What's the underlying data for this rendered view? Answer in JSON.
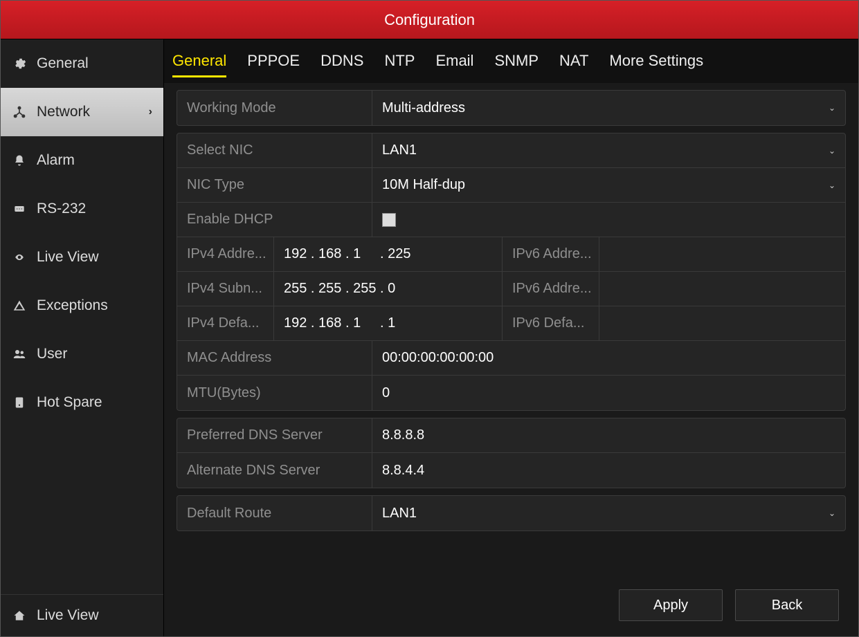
{
  "header": {
    "title": "Configuration"
  },
  "sidebar": {
    "items": [
      {
        "id": "general",
        "label": "General",
        "icon": "gear-icon"
      },
      {
        "id": "network",
        "label": "Network",
        "icon": "network-icon",
        "active": true
      },
      {
        "id": "alarm",
        "label": "Alarm",
        "icon": "bell-icon"
      },
      {
        "id": "rs232",
        "label": "RS-232",
        "icon": "serial-icon"
      },
      {
        "id": "liveview",
        "label": "Live View",
        "icon": "eye-icon"
      },
      {
        "id": "exceptions",
        "label": "Exceptions",
        "icon": "warning-icon"
      },
      {
        "id": "user",
        "label": "User",
        "icon": "users-icon"
      },
      {
        "id": "hotspare",
        "label": "Hot Spare",
        "icon": "disk-icon"
      }
    ],
    "bottom": {
      "label": "Live View",
      "icon": "home-icon"
    }
  },
  "tabs": [
    {
      "id": "general",
      "label": "General",
      "active": true
    },
    {
      "id": "pppoe",
      "label": "PPPOE"
    },
    {
      "id": "ddns",
      "label": "DDNS"
    },
    {
      "id": "ntp",
      "label": "NTP"
    },
    {
      "id": "email",
      "label": "Email"
    },
    {
      "id": "snmp",
      "label": "SNMP"
    },
    {
      "id": "nat",
      "label": "NAT"
    },
    {
      "id": "more",
      "label": "More Settings"
    }
  ],
  "form": {
    "working_mode": {
      "label": "Working Mode",
      "value": "Multi-address"
    },
    "select_nic": {
      "label": "Select NIC",
      "value": "LAN1"
    },
    "nic_type": {
      "label": "NIC Type",
      "value": "10M Half-dup"
    },
    "enable_dhcp": {
      "label": "Enable DHCP",
      "checked": false
    },
    "ipv4_address": {
      "label": "IPv4 Addre...",
      "value": "192 . 168 . 1     . 225"
    },
    "ipv4_subnet": {
      "label": "IPv4 Subn...",
      "value": "255 . 255 . 255 . 0"
    },
    "ipv4_gateway": {
      "label": "IPv4 Defa...",
      "value": "192 . 168 . 1     . 1"
    },
    "ipv6_address": {
      "label": "IPv6 Addre...",
      "value": ""
    },
    "ipv6_address2": {
      "label": "IPv6 Addre...",
      "value": ""
    },
    "ipv6_gateway": {
      "label": "IPv6 Defa...",
      "value": ""
    },
    "mac_address": {
      "label": "MAC Address",
      "value": "00:00:00:00:00:00"
    },
    "mtu": {
      "label": "MTU(Bytes)",
      "value": "0"
    },
    "dns_preferred": {
      "label": "Preferred DNS Server",
      "value": "8.8.8.8"
    },
    "dns_alternate": {
      "label": "Alternate DNS Server",
      "value": "8.8.4.4"
    },
    "default_route": {
      "label": "Default Route",
      "value": "LAN1"
    }
  },
  "footer": {
    "apply_label": "Apply",
    "back_label": "Back"
  }
}
